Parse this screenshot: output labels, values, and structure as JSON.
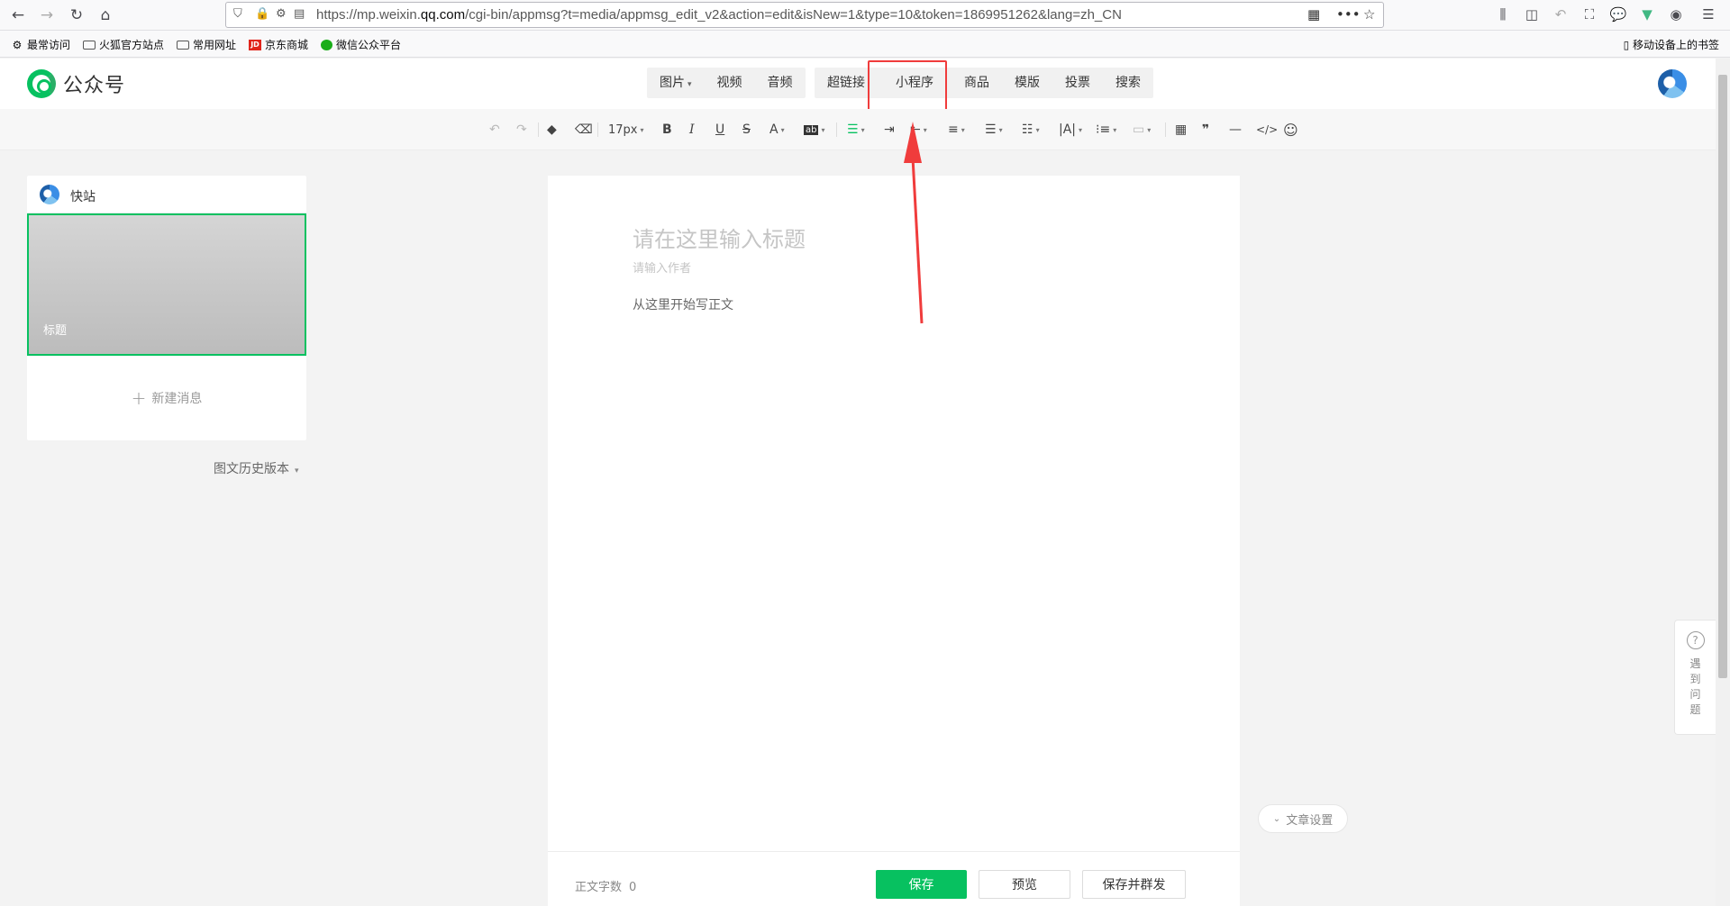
{
  "browser": {
    "url_prefix": "https://mp.weixin.",
    "url_domain": "qq.com",
    "url_suffix": "/cgi-bin/appmsg?t=media/appmsg_edit_v2&action=edit&isNew=1&type=10&token=1869951262&lang=zh_CN"
  },
  "bookmarks": {
    "items": [
      {
        "label": "最常访问",
        "icon": "gear-icon"
      },
      {
        "label": "火狐官方站点",
        "icon": "folder-icon"
      },
      {
        "label": "常用网址",
        "icon": "folder-icon"
      },
      {
        "label": "京东商城",
        "icon": "jd-icon"
      },
      {
        "label": "微信公众平台",
        "icon": "wechat-icon"
      }
    ],
    "mobile": "移动设备上的书签",
    "jd_logo": "JD"
  },
  "header": {
    "logo_text": "公众号",
    "media_tools": [
      "图片",
      "视频",
      "音频"
    ],
    "insert_tools": [
      "超链接",
      "小程序",
      "商品",
      "模版",
      "投票",
      "搜索"
    ]
  },
  "format_bar": {
    "font_size": "17px",
    "quote": "❞",
    "code": "</>"
  },
  "left_panel": {
    "account_name": "快站",
    "cover_title": "标题",
    "new_message": "新建消息",
    "history": "图文历史版本"
  },
  "editor": {
    "title_placeholder": "请在这里输入标题",
    "author_placeholder": "请输入作者",
    "body_placeholder": "从这里开始写正文"
  },
  "footer": {
    "word_count_label": "正文字数",
    "word_count": "0",
    "save": "保存",
    "preview": "预览",
    "save_and_send": "保存并群发"
  },
  "side": {
    "article_settings": "文章设置",
    "help": "遇到问题"
  },
  "colors": {
    "accent": "#07c160",
    "highlight": "#f03c3c"
  }
}
